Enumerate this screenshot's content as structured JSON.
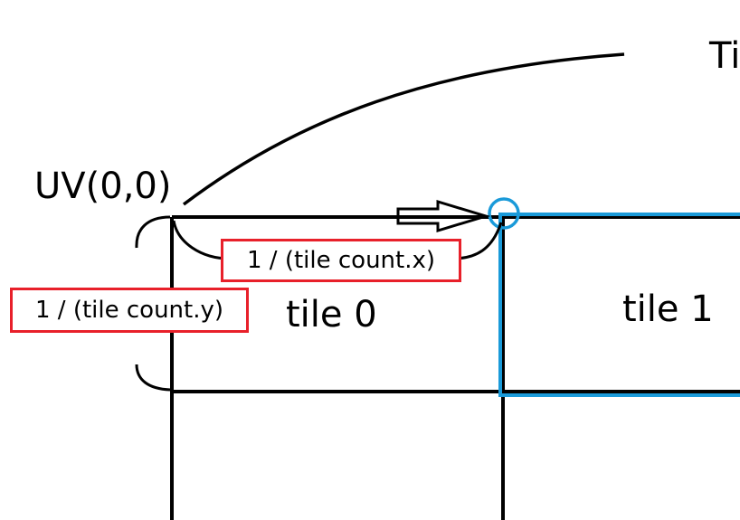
{
  "labels": {
    "uv_origin": "UV(0,0)",
    "ti_fragment": "Ti",
    "tile0": "tile 0",
    "tile1": "tile 1",
    "tile_step_x": "1 / (tile count.x)",
    "tile_step_y": "1 / (tile count.y)"
  },
  "colors": {
    "grid_lines": "#000000",
    "highlight_tile": "#1a9ad9",
    "formula_box_border": "#e8202a"
  }
}
